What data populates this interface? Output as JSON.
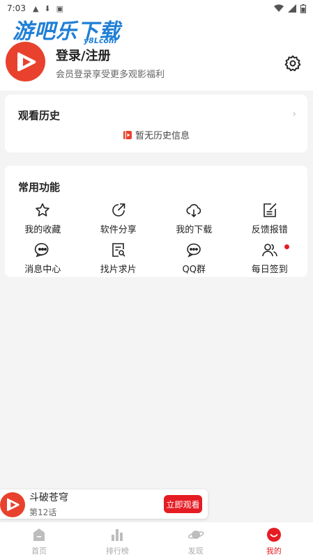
{
  "status_bar": {
    "time": "7:03"
  },
  "watermark": {
    "text": "游吧乐下载",
    "sub": "y8Lcom"
  },
  "profile": {
    "title": "登录/注册",
    "subtitle": "会员登录享受更多观影福利"
  },
  "history": {
    "title": "观看历史",
    "empty_text": "暂无历史信息"
  },
  "functions": {
    "title": "常用功能",
    "items": [
      {
        "label": "我的收藏",
        "icon": "star-icon"
      },
      {
        "label": "软件分享",
        "icon": "share-icon"
      },
      {
        "label": "我的下载",
        "icon": "download-cloud-icon"
      },
      {
        "label": "反馈报错",
        "icon": "feedback-edit-icon"
      },
      {
        "label": "消息中心",
        "icon": "message-icon"
      },
      {
        "label": "找片求片",
        "icon": "search-doc-icon"
      },
      {
        "label": "QQ群",
        "icon": "qq-chat-icon"
      },
      {
        "label": "每日签到",
        "icon": "users-icon"
      }
    ]
  },
  "mini_player": {
    "title": "斗破苍穹",
    "episode": "第12话",
    "watch_label": "立即观看"
  },
  "tabs": [
    {
      "label": "首页",
      "icon": "home-icon",
      "active": false
    },
    {
      "label": "排行榜",
      "icon": "bar-chart-icon",
      "active": false
    },
    {
      "label": "发现",
      "icon": "planet-icon",
      "active": false
    },
    {
      "label": "我的",
      "icon": "smile-icon",
      "active": true
    }
  ],
  "colors": {
    "accent": "#e51c23",
    "avatar": "#e8422e",
    "watermark": "#1f7fd6"
  }
}
